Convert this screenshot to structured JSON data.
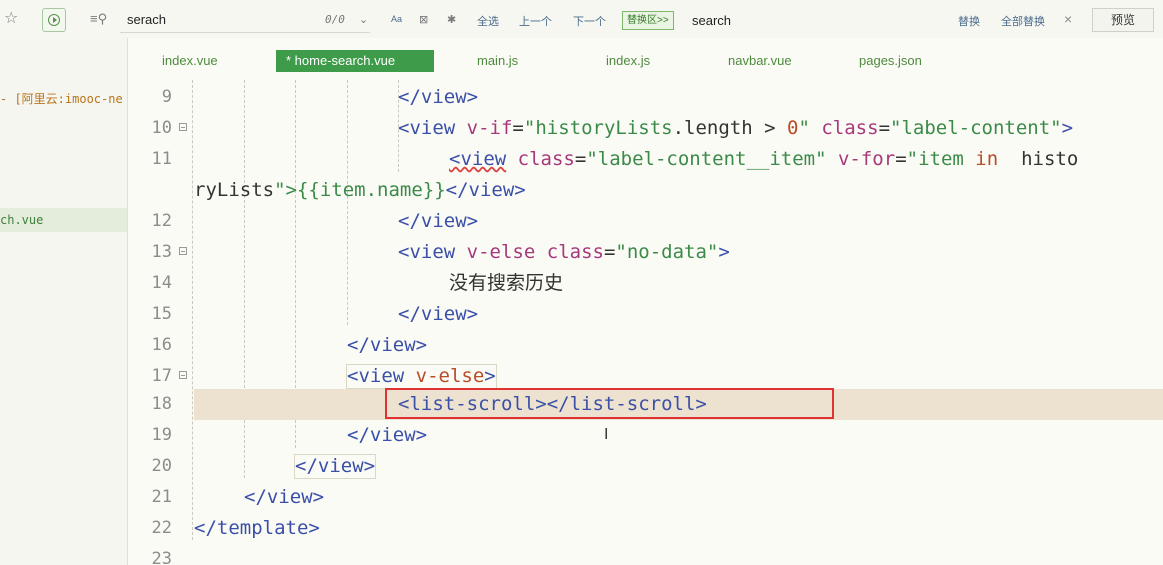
{
  "toolbar": {
    "search_value": "serach",
    "match_count": "0/0",
    "case_label": "Aa",
    "select_all": "全选",
    "prev": "上一个",
    "next": "下一个",
    "replace_toggle": "替换区>>",
    "replace_value": "search",
    "replace": "替换",
    "replace_all": "全部替换",
    "close": "×",
    "preview": "预览"
  },
  "sidebar": {
    "project_label": "- [阿里云:imooc-ne",
    "active_file": "ch.vue"
  },
  "tabs": [
    {
      "label": "index.vue",
      "active": false
    },
    {
      "label": "* home-search.vue",
      "active": true
    },
    {
      "label": "main.js",
      "active": false
    },
    {
      "label": "index.js",
      "active": false
    },
    {
      "label": "navbar.vue",
      "active": false
    },
    {
      "label": "pages.json",
      "active": false
    }
  ],
  "editor": {
    "line_numbers": [
      "9",
      "10",
      "11",
      "",
      "12",
      "13",
      "14",
      "15",
      "16",
      "17",
      "18",
      "19",
      "20",
      "21",
      "22",
      "23"
    ],
    "current_line": "18",
    "colors": {
      "tag": "#3a4fa8",
      "attr": "#a6387c",
      "string": "#3b8a49",
      "number": "#b84c2a",
      "highlight": "#e03232"
    },
    "tokens": {
      "close_view": "</view>",
      "open_view": "<view",
      "v_if": "v-if",
      "eq": "=",
      "hist_cond_open": "\"historyLists",
      "length": ".length",
      "gt": " > ",
      "zero": "0",
      "q": "\"",
      "class": "class",
      "label_content": "\"label-content\"",
      "gt_close": ">",
      "view_tag_sq": "<view",
      "label_item": "\"label-content__item\"",
      "v_for": "v-for",
      "item_str": "\"item",
      "in": "in",
      "histo": "histo",
      "rylists": "ryLists",
      "mustache": "\">{{item.name}}",
      "v_else": "v-else",
      "no_data": "\"no-data\"",
      "empty_text": "没有搜索历史",
      "list_scroll": "<list-scroll></list-scroll>",
      "close_template": "</template>"
    }
  }
}
